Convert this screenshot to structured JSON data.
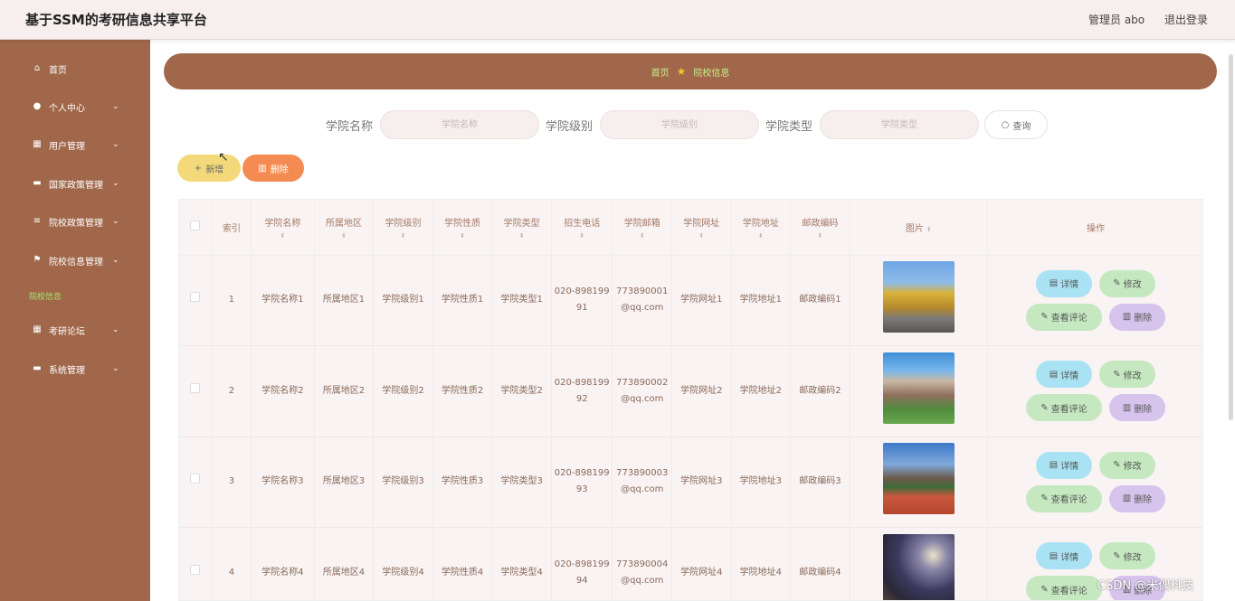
{
  "header": {
    "title": "基于SSM的考研信息共享平台",
    "user": "管理员 abo",
    "logout": "退出登录"
  },
  "sidebar": {
    "items": [
      {
        "label": "首页",
        "icon": "home-icon",
        "has_children": false
      },
      {
        "label": "个人中心",
        "icon": "user-icon",
        "has_children": true
      },
      {
        "label": "用户管理",
        "icon": "grid-icon",
        "has_children": true
      },
      {
        "label": "国家政策管理",
        "icon": "monitor-icon",
        "has_children": true
      },
      {
        "label": "院校政策管理",
        "icon": "list-icon",
        "has_children": true
      },
      {
        "label": "院校信息管理",
        "icon": "flag-icon",
        "has_children": true
      },
      {
        "label": "考研论坛",
        "icon": "grid-icon",
        "has_children": true
      },
      {
        "label": "系统管理",
        "icon": "monitor-icon",
        "has_children": true
      }
    ],
    "active_sub": "院校信息"
  },
  "breadcrumb": {
    "home": "首页",
    "current": "院校信息"
  },
  "search": {
    "name_label": "学院名称",
    "name_placeholder": "学院名称",
    "level_label": "学院级别",
    "level_placeholder": "学院级别",
    "type_label": "学院类型",
    "type_placeholder": "学院类型",
    "query": "查询"
  },
  "toolbar": {
    "add": "新增",
    "delete": "删除"
  },
  "table": {
    "columns": [
      "索引",
      "学院名称",
      "所属地区",
      "学院级别",
      "学院性质",
      "学院类型",
      "招生电话",
      "学院邮箱",
      "学院网址",
      "学院地址",
      "邮政编码",
      "图片",
      "操作"
    ],
    "rows": [
      {
        "index": "1",
        "name": "学院名称1",
        "region": "所属地区1",
        "level": "学院级别1",
        "nature": "学院性质1",
        "type": "学院类型1",
        "phone": "020-89819991",
        "email": "773890001@qq.com",
        "website": "学院网址1",
        "address": "学院地址1",
        "postcode": "邮政编码1",
        "image": "campus-avenue-photo"
      },
      {
        "index": "2",
        "name": "学院名称2",
        "region": "所属地区2",
        "level": "学院级别2",
        "nature": "学院性质2",
        "type": "学院类型2",
        "phone": "020-89819992",
        "email": "773890002@qq.com",
        "website": "学院网址2",
        "address": "学院地址2",
        "postcode": "邮政编码2",
        "image": "campus-building-photo"
      },
      {
        "index": "3",
        "name": "学院名称3",
        "region": "所属地区3",
        "level": "学院级别3",
        "nature": "学院性质3",
        "type": "学院类型3",
        "phone": "020-89819993",
        "email": "773890003@qq.com",
        "website": "学院网址3",
        "address": "学院地址3",
        "postcode": "邮政编码3",
        "image": "running-track-photo"
      },
      {
        "index": "4",
        "name": "学院名称4",
        "region": "所属地区4",
        "level": "学院级别4",
        "nature": "学院性质4",
        "type": "学院类型4",
        "phone": "020-89819994",
        "email": "773890004@qq.com",
        "website": "学院网址4",
        "address": "学院地址4",
        "postcode": "邮政编码4",
        "image": "night-campus-photo"
      }
    ],
    "actions": {
      "detail": "详情",
      "edit": "修改",
      "comments": "查看评论",
      "remove": "删除"
    }
  },
  "watermark": "CSDN @米偶科技",
  "colors": {
    "sidebar": "#a0674a",
    "accent_green": "#c6f08b",
    "add_button": "#f4d97a",
    "delete_button": "#f48b52"
  }
}
